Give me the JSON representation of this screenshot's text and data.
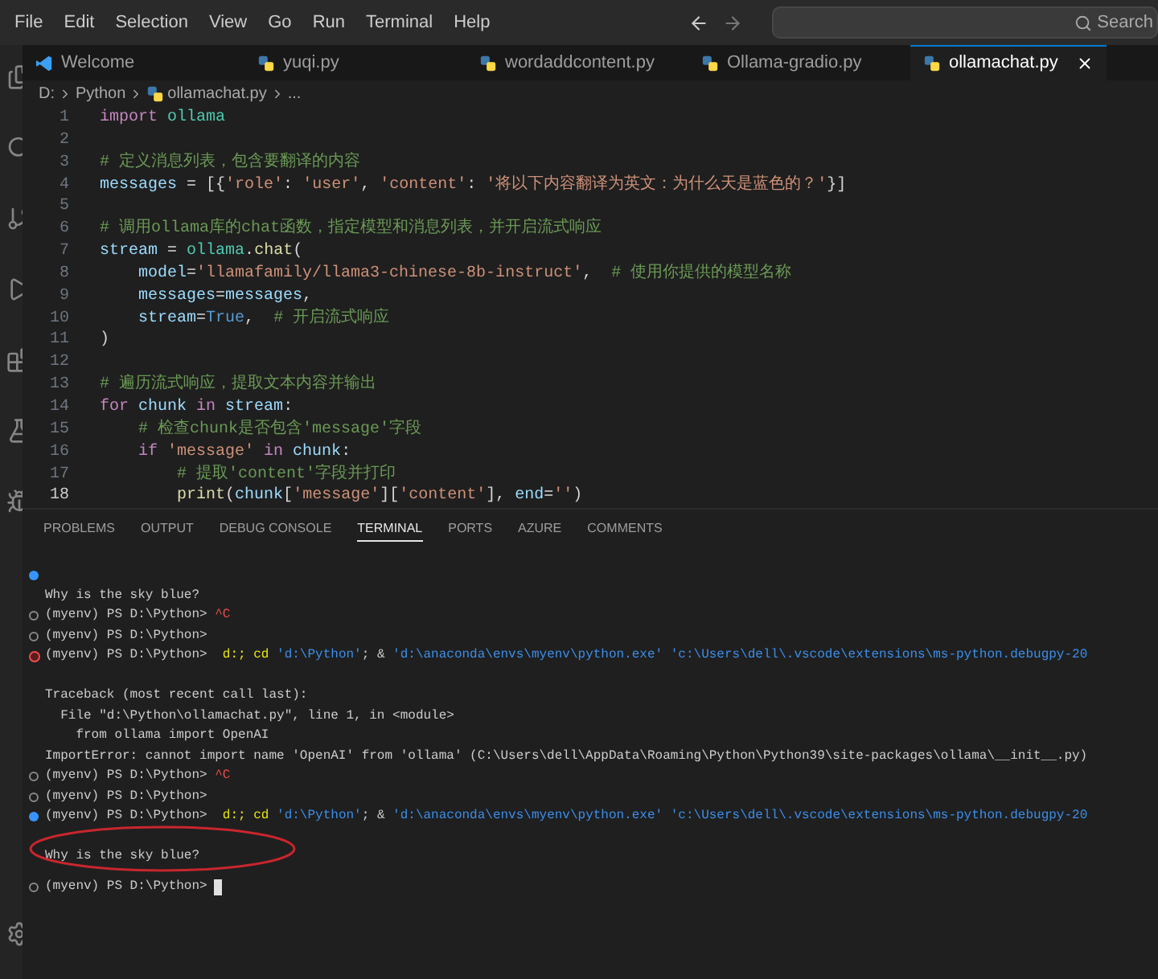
{
  "menu": [
    "File",
    "Edit",
    "Selection",
    "View",
    "Go",
    "Run",
    "Terminal",
    "Help"
  ],
  "search": {
    "placeholder": "Search"
  },
  "tabs": [
    {
      "label": "Welcome",
      "kind": "welcome",
      "selected": false
    },
    {
      "label": "yuqi.py",
      "kind": "python",
      "selected": false
    },
    {
      "label": "wordaddcontent.py",
      "kind": "python",
      "selected": false
    },
    {
      "label": "Ollama-gradio.py",
      "kind": "python",
      "selected": false
    },
    {
      "label": "ollamachat.py",
      "kind": "python",
      "selected": true
    }
  ],
  "breadcrumb": [
    "D:",
    "Python",
    "ollamachat.py",
    "..."
  ],
  "code": [
    {
      "number": "1",
      "segments": [
        {
          "kind": "keyword",
          "text": "import "
        },
        {
          "kind": "module",
          "text": "ollama"
        }
      ]
    },
    {
      "number": "2"
    },
    {
      "number": "3",
      "segments": [
        {
          "kind": "comment",
          "text": "# 定义消息列表，包含要翻译的内容"
        }
      ]
    },
    {
      "number": "4",
      "segments": [
        {
          "kind": "var",
          "text": "messages"
        },
        {
          "kind": "plain",
          "text": " = [{"
        },
        {
          "kind": "string",
          "text": "'role'"
        },
        {
          "kind": "plain",
          "text": ": "
        },
        {
          "kind": "string",
          "text": "'user'"
        },
        {
          "kind": "plain",
          "text": ", "
        },
        {
          "kind": "string",
          "text": "'content'"
        },
        {
          "kind": "plain",
          "text": ": "
        },
        {
          "kind": "string",
          "text": "'将以下内容翻译为英文：为什么天是蓝色的？'"
        },
        {
          "kind": "plain",
          "text": "}]"
        }
      ]
    },
    {
      "number": "5"
    },
    {
      "number": "6",
      "segments": [
        {
          "kind": "comment",
          "text": "# 调用ollama库的chat函数，指定模型和消息列表，并开启流式响应"
        }
      ]
    },
    {
      "number": "7",
      "segments": [
        {
          "kind": "var",
          "text": "stream"
        },
        {
          "kind": "plain",
          "text": " = "
        },
        {
          "kind": "module",
          "text": "ollama"
        },
        {
          "kind": "plain",
          "text": "."
        },
        {
          "kind": "func",
          "text": "chat"
        },
        {
          "kind": "plain",
          "text": "("
        }
      ]
    },
    {
      "number": "8",
      "segments": [
        {
          "kind": "var",
          "text": "    model"
        },
        {
          "kind": "plain",
          "text": "="
        },
        {
          "kind": "string",
          "text": "'llamafamily/llama3-chinese-8b-instruct'"
        },
        {
          "kind": "plain",
          "text": ",  "
        },
        {
          "kind": "comment",
          "text": "# 使用你提供的模型名称"
        }
      ]
    },
    {
      "number": "9",
      "segments": [
        {
          "kind": "var",
          "text": "    messages"
        },
        {
          "kind": "plain",
          "text": "="
        },
        {
          "kind": "var",
          "text": "messages"
        },
        {
          "kind": "plain",
          "text": ","
        }
      ]
    },
    {
      "number": "10",
      "segments": [
        {
          "kind": "var",
          "text": "    stream"
        },
        {
          "kind": "plain",
          "text": "="
        },
        {
          "kind": "const",
          "text": "True"
        },
        {
          "kind": "plain",
          "text": ",  "
        },
        {
          "kind": "comment",
          "text": "# 开启流式响应"
        }
      ]
    },
    {
      "number": "11",
      "segments": [
        {
          "kind": "plain",
          "text": ")"
        }
      ]
    },
    {
      "number": "12"
    },
    {
      "number": "13",
      "segments": [
        {
          "kind": "comment",
          "text": "# 遍历流式响应，提取文本内容并输出"
        }
      ]
    },
    {
      "number": "14",
      "segments": [
        {
          "kind": "keyword",
          "text": "for "
        },
        {
          "kind": "var",
          "text": "chunk "
        },
        {
          "kind": "keyword",
          "text": "in "
        },
        {
          "kind": "var",
          "text": "stream"
        },
        {
          "kind": "plain",
          "text": ":"
        }
      ]
    },
    {
      "number": "15",
      "segments": [
        {
          "kind": "comment",
          "text": "    # 检查chunk是否包含'message'字段"
        }
      ]
    },
    {
      "number": "16",
      "segments": [
        {
          "kind": "keyword",
          "text": "    if "
        },
        {
          "kind": "string",
          "text": "'message'"
        },
        {
          "kind": "keyword",
          "text": " in "
        },
        {
          "kind": "var",
          "text": "chunk"
        },
        {
          "kind": "plain",
          "text": ":"
        }
      ]
    },
    {
      "number": "17",
      "segments": [
        {
          "kind": "comment",
          "text": "        # 提取'content'字段并打印"
        }
      ]
    },
    {
      "number": "18",
      "segments": [
        {
          "kind": "func",
          "text": "        print"
        },
        {
          "kind": "plain",
          "text": "("
        },
        {
          "kind": "var",
          "text": "chunk"
        },
        {
          "kind": "plain",
          "text": "["
        },
        {
          "kind": "string",
          "text": "'message'"
        },
        {
          "kind": "plain",
          "text": "]["
        },
        {
          "kind": "string",
          "text": "'content'"
        },
        {
          "kind": "plain",
          "text": "], "
        },
        {
          "kind": "var",
          "text": "end"
        },
        {
          "kind": "plain",
          "text": "="
        },
        {
          "kind": "string",
          "text": "''"
        },
        {
          "kind": "plain",
          "text": ")"
        }
      ]
    }
  ],
  "panel_tabs": [
    {
      "label": "PROBLEMS",
      "selected": false
    },
    {
      "label": "OUTPUT",
      "selected": false
    },
    {
      "label": "DEBUG CONSOLE",
      "selected": false
    },
    {
      "label": "TERMINAL",
      "selected": true
    },
    {
      "label": "PORTS",
      "selected": false
    },
    {
      "label": "AZURE",
      "selected": false
    },
    {
      "label": "COMMENTS",
      "selected": false
    }
  ],
  "terminal": [
    {
      "kind": "success",
      "cursor": false
    },
    {
      "kind": "none",
      "cursor": false,
      "segments": [
        {
          "kind": "plain",
          "text": "Why is the sky blue?"
        }
      ]
    },
    {
      "kind": "done",
      "cursor": false,
      "segments": [
        {
          "kind": "plain",
          "text": "(myenv) PS D:\\Python> "
        },
        {
          "kind": "interrupt",
          "text": "^C"
        }
      ]
    },
    {
      "kind": "done",
      "cursor": false,
      "segments": [
        {
          "kind": "plain",
          "text": "(myenv) PS D:\\Python>"
        }
      ]
    },
    {
      "kind": "error",
      "cursor": false,
      "segments": [
        {
          "kind": "plain",
          "text": "(myenv) PS D:\\Python>  "
        },
        {
          "kind": "command",
          "text": "d:; cd "
        },
        {
          "kind": "string",
          "text": "'d:\\Python'"
        },
        {
          "kind": "plain",
          "text": "; & "
        },
        {
          "kind": "string",
          "text": "'d:\\anaconda\\envs\\myenv\\python.exe' 'c:\\Users\\dell\\.vscode\\extensions\\ms-python.debugpy-20"
        }
      ]
    },
    {
      "kind": "none",
      "cursor": false
    },
    {
      "kind": "none",
      "cursor": false,
      "segments": [
        {
          "kind": "plain",
          "text": "Traceback (most recent call last):"
        }
      ]
    },
    {
      "kind": "none",
      "cursor": false,
      "segments": [
        {
          "kind": "plain",
          "text": "  File \"d:\\Python\\ollamachat.py\", line 1, in <module>"
        }
      ]
    },
    {
      "kind": "none",
      "cursor": false,
      "segments": [
        {
          "kind": "plain",
          "text": "    from ollama import OpenAI"
        }
      ]
    },
    {
      "kind": "none",
      "cursor": false,
      "segments": [
        {
          "kind": "plain",
          "text": "ImportError: cannot import name 'OpenAI' from 'ollama' (C:\\Users\\dell\\AppData\\Roaming\\Python\\Python39\\site-packages\\ollama\\__init__.py)"
        }
      ]
    },
    {
      "kind": "done",
      "cursor": false,
      "segments": [
        {
          "kind": "plain",
          "text": "(myenv) PS D:\\Python> "
        },
        {
          "kind": "interrupt",
          "text": "^C"
        }
      ]
    },
    {
      "kind": "done",
      "cursor": false,
      "segments": [
        {
          "kind": "plain",
          "text": "(myenv) PS D:\\Python>"
        }
      ]
    },
    {
      "kind": "success",
      "cursor": false,
      "segments": [
        {
          "kind": "plain",
          "text": "(myenv) PS D:\\Python>  "
        },
        {
          "kind": "command",
          "text": "d:; cd "
        },
        {
          "kind": "string",
          "text": "'d:\\Python'"
        },
        {
          "kind": "plain",
          "text": "; & "
        },
        {
          "kind": "string",
          "text": "'d:\\anaconda\\envs\\myenv\\python.exe' 'c:\\Users\\dell\\.vscode\\extensions\\ms-python.debugpy-20"
        }
      ]
    },
    {
      "kind": "none",
      "cursor": false
    },
    {
      "kind": "none",
      "cursor": false,
      "segments": [
        {
          "kind": "plain",
          "text": "Why is the sky blue?"
        }
      ]
    },
    {
      "kind": "done",
      "cursor": true,
      "segments": [
        {
          "kind": "plain",
          "text": "(myenv) PS D:\\Python>"
        }
      ]
    }
  ]
}
